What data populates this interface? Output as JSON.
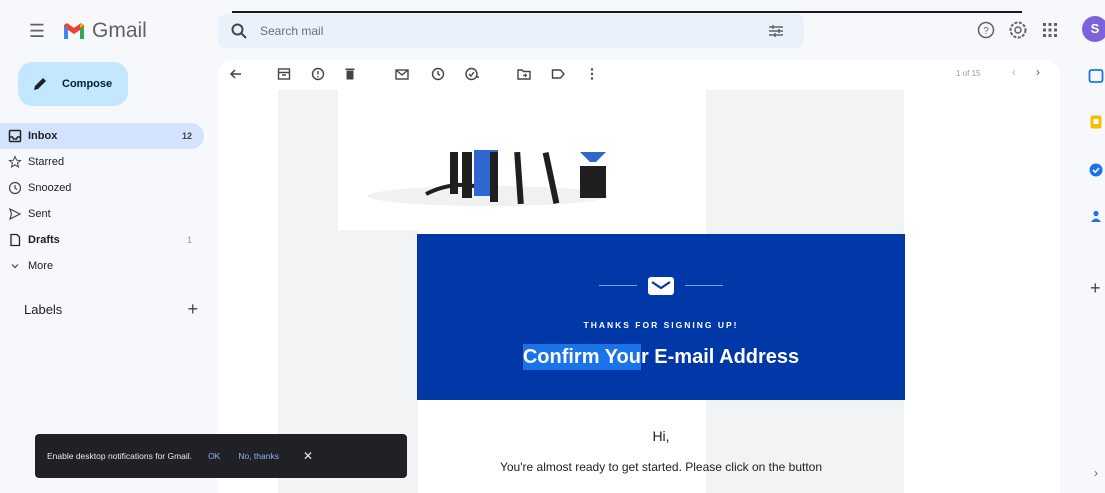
{
  "app": {
    "name": "Gmail"
  },
  "search": {
    "placeholder": "Search mail"
  },
  "compose": {
    "label": "Compose"
  },
  "nav": {
    "items": [
      {
        "label": "Inbox",
        "count": "12",
        "icon": "inbox-icon"
      },
      {
        "label": "Starred",
        "count": "",
        "icon": "star-icon"
      },
      {
        "label": "Snoozed",
        "count": "",
        "icon": "clock-icon"
      },
      {
        "label": "Sent",
        "count": "",
        "icon": "send-icon"
      },
      {
        "label": "Drafts",
        "count": "1",
        "icon": "draft-icon"
      },
      {
        "label": "More",
        "count": "",
        "icon": "chevron-down-icon"
      }
    ]
  },
  "labels": {
    "title": "Labels",
    "add": "+"
  },
  "toolbar": {
    "pager": "1 of 15"
  },
  "email": {
    "kicker": "THANKS FOR SIGNING UP!",
    "title_highlight": "Confirm You",
    "title_rest": "r E-mail Address",
    "greeting": "Hi,",
    "body": "You're almost ready to get started. Please click on the button"
  },
  "snackbar": {
    "message": "Enable desktop notifications for Gmail.",
    "ok": "OK",
    "no": "No, thanks",
    "close": "✕"
  },
  "avatar": {
    "letter": "S"
  },
  "colors": {
    "banner": "#0038a8",
    "compose": "#c2e7ff",
    "active_nav": "#d3e3fd",
    "avatar": "#7c63d9"
  }
}
